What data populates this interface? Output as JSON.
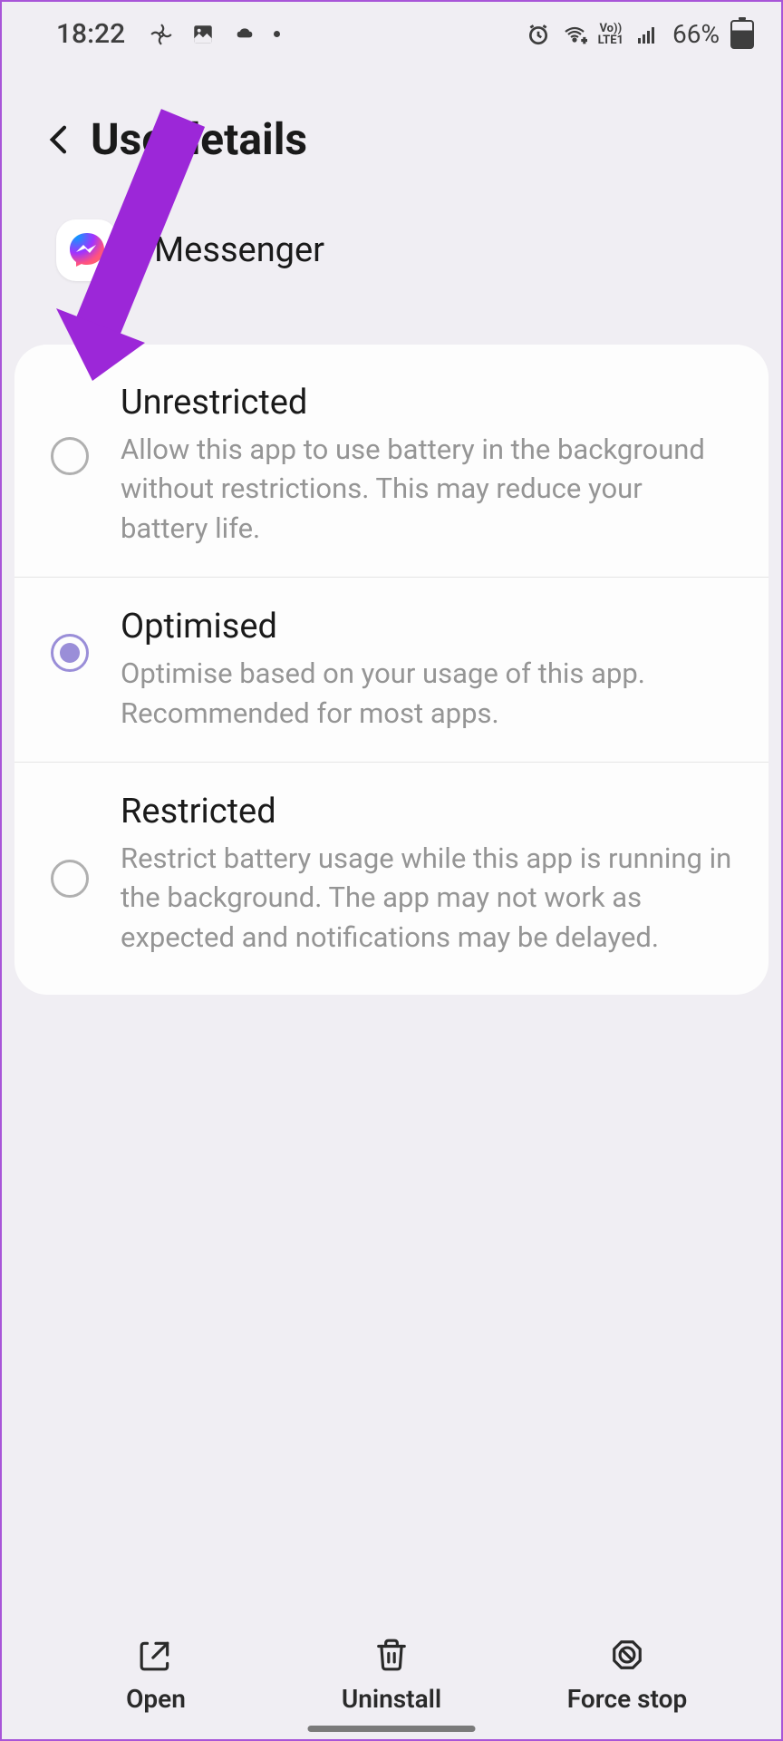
{
  "status_bar": {
    "time": "18:22",
    "battery_percent": "66%"
  },
  "header": {
    "title": "Use details"
  },
  "app": {
    "name": "Messenger"
  },
  "options": [
    {
      "title": "Unrestricted",
      "description": "Allow this app to use battery in the background without restrictions. This may reduce your battery life.",
      "selected": false
    },
    {
      "title": "Optimised",
      "description": "Optimise based on your usage of this app. Recommended for most apps.",
      "selected": true
    },
    {
      "title": "Restricted",
      "description": "Restrict battery usage while this app is running in the background. The app may not work as expected and notifications may be delayed.",
      "selected": false
    }
  ],
  "bottom_actions": {
    "open": "Open",
    "uninstall": "Uninstall",
    "force_stop": "Force stop"
  },
  "annotation": {
    "arrow_color": "#9c27d8"
  }
}
